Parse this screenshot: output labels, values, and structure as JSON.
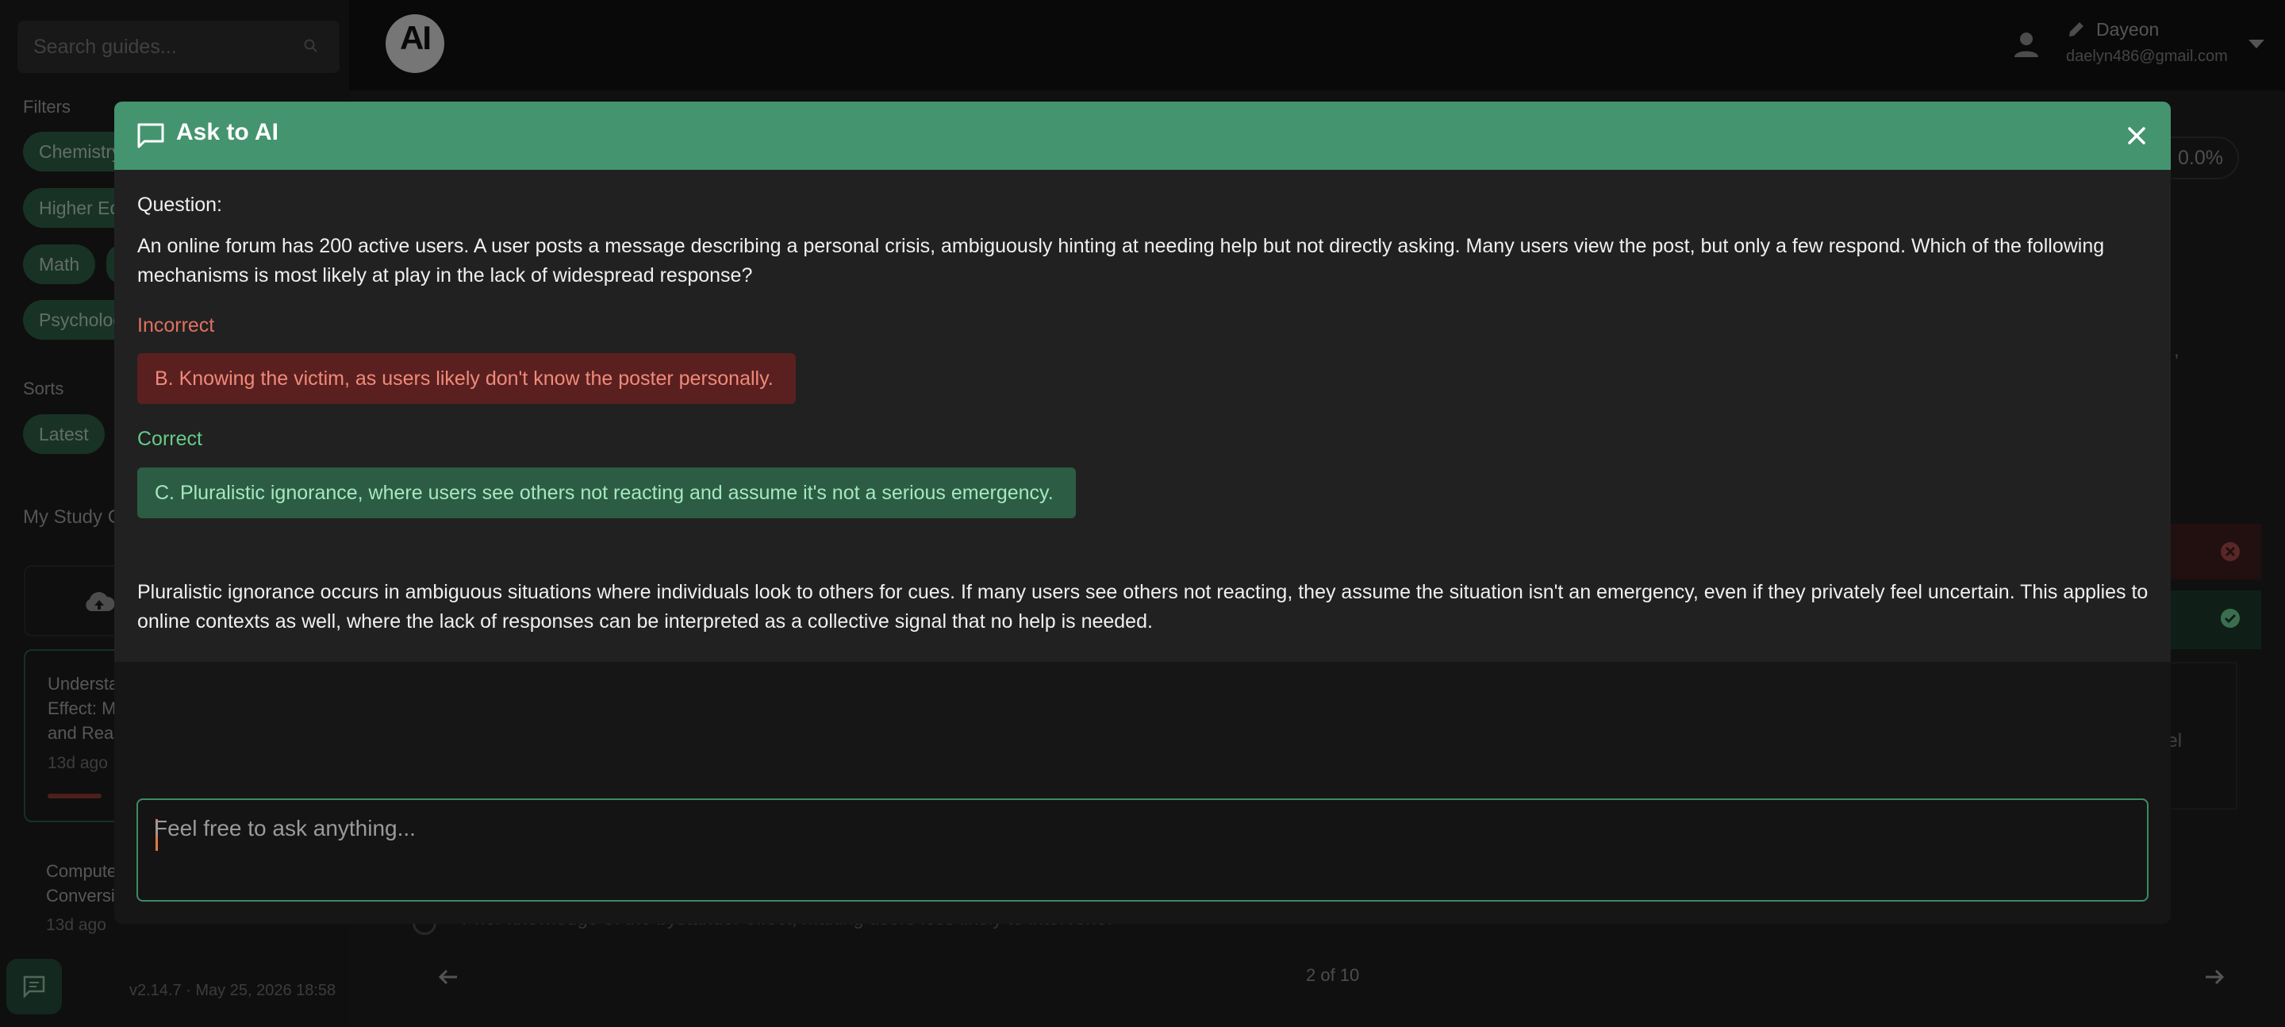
{
  "sidebar": {
    "search_placeholder": "Search guides...",
    "filters_label": "Filters",
    "filter_chips": [
      "Chemistry",
      "Higher Ed",
      "Math",
      "Psycholog"
    ],
    "sorts_label": "Sorts",
    "sort_chip": "Latest",
    "my_study_label": "My Study G",
    "guides": [
      {
        "title_lines": [
          "Understa",
          "Effect: M",
          "and Real-"
        ],
        "date": "13d ago",
        "progress": 0.18
      },
      {
        "title_lines": [
          "Compute",
          "Conversi"
        ],
        "date": "13d ago"
      }
    ],
    "version": "v2.14.7 · May 25, 2026 18:58"
  },
  "header": {
    "logo_text": "AI",
    "user_name": "Dayeon",
    "user_email": "daelyn486@gmail.com"
  },
  "background": {
    "score": "0.0%",
    "snip_right_1": ",",
    "snip_right_2": "eel",
    "bottom_option": "Prior knowledge of the bystander effect, making users less likely to intervene.",
    "pager": "2 of 10"
  },
  "modal": {
    "title": "Ask to AI",
    "question_label": "Question:",
    "question_text": "An online forum has 200 active users. A user posts a message describing a personal crisis, ambiguously hinting at needing help but not directly asking. Many users view the post, but only a few respond. Which of the following mechanisms is most likely at play in the lack of widespread response?",
    "incorrect_label": "Incorrect",
    "incorrect_answer": "B. Knowing the victim, as users likely don't know the poster personally.",
    "correct_label": "Correct",
    "correct_answer": "C. Pluralistic ignorance, where users see others not reacting and assume it's not a serious emergency.",
    "explanation": "Pluralistic ignorance occurs in ambiguous situations where individuals look to others for cues. If many users see others not reacting, they assume the situation isn't an emergency, even if they privately feel uncertain. This applies to online contexts as well, where the lack of responses can be interpreted as a collective signal that no help is needed.",
    "input_placeholder": "Feel free to ask anything..."
  },
  "colors": {
    "header_green": "#449470",
    "incorrect_bg": "#5a2020",
    "correct_bg": "#2c5c44"
  }
}
